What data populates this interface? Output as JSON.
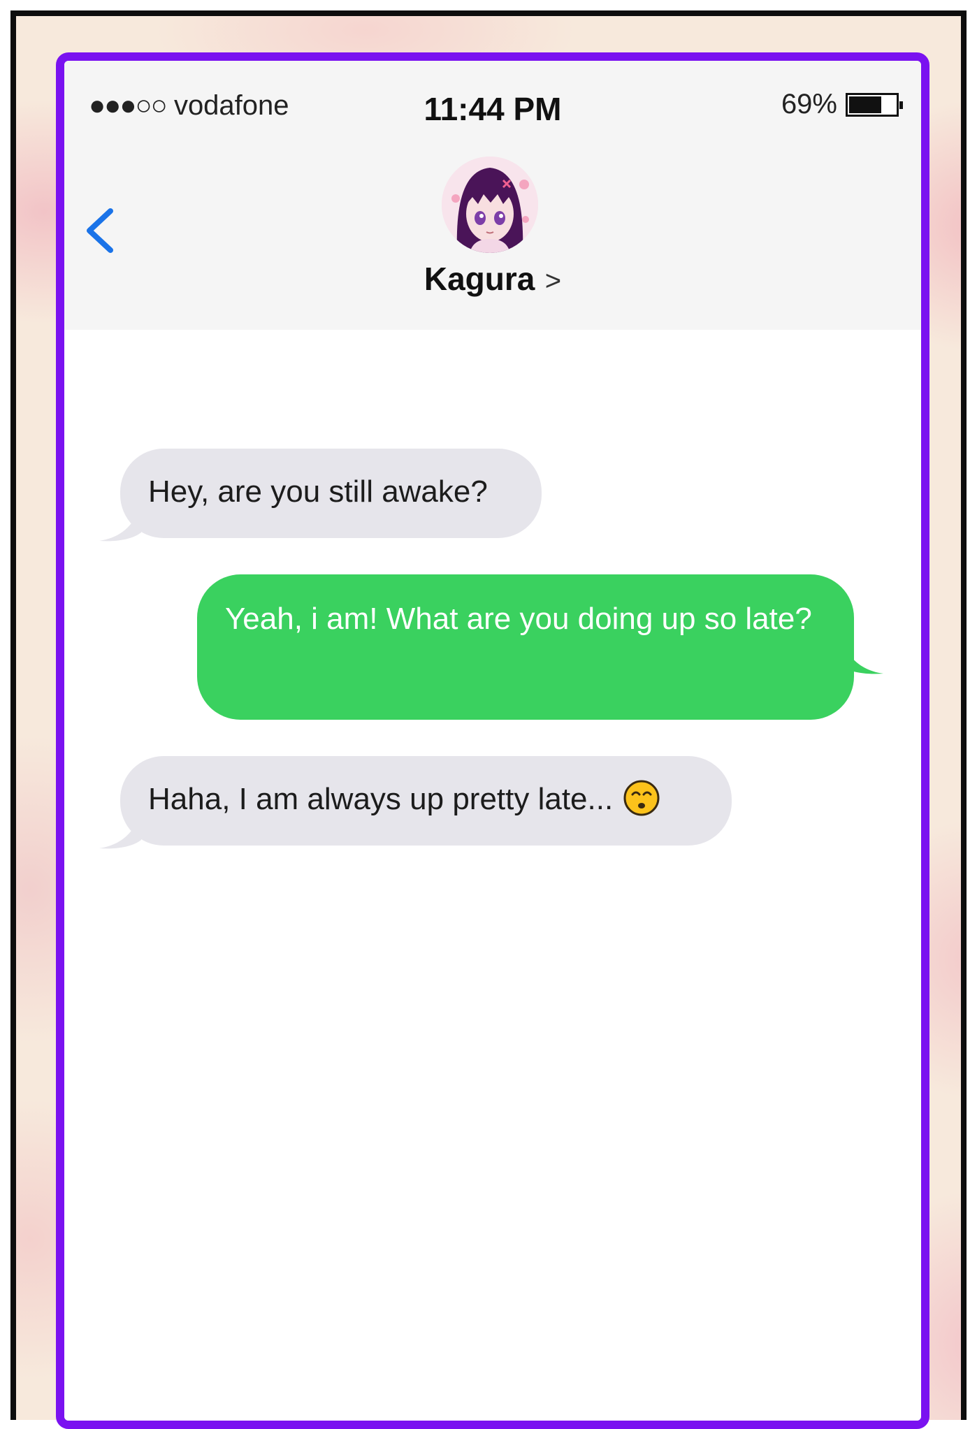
{
  "status_bar": {
    "signal": "●●●○○",
    "carrier": "vodafone",
    "time": "11:44 PM",
    "battery": "69%",
    "battery_level": 0.69
  },
  "header": {
    "contact_name": "Kagura",
    "contact_chevron": ">"
  },
  "messages": [
    {
      "direction": "received",
      "text": "Hey, are you still awake?"
    },
    {
      "direction": "sent",
      "text": "Yeah, i am! What are you doing up so late?"
    },
    {
      "direction": "received",
      "text": "Haha, I am always up pretty late...",
      "icon": "smiling-face-emoji-icon"
    }
  ],
  "colors": {
    "phone_border": "#7a12f0",
    "sent_bubble": "#3ad15f",
    "received_bubble": "#e6e5eb",
    "back_arrow": "#1a73e8"
  }
}
